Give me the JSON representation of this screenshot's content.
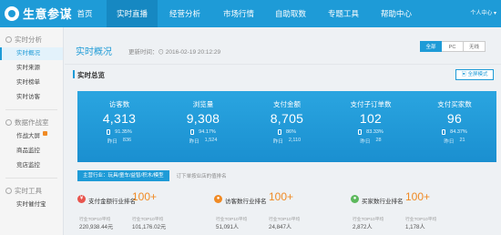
{
  "app": {
    "title": "生意参谋"
  },
  "nav": {
    "items": [
      "首页",
      "实时直播",
      "经营分析",
      "市场行情",
      "自助取数",
      "专题工具",
      "帮助中心"
    ],
    "active_index": 1,
    "user_menu": "个人中心 ▾"
  },
  "sidebar": {
    "groups": [
      {
        "title": "实时分析",
        "items": [
          "实时概况",
          "实时来源",
          "实时榜单",
          "实时访客"
        ]
      },
      {
        "title": "数据作战室",
        "items": [
          "作战大屏",
          "商品监控",
          "竞店监控"
        ]
      },
      {
        "title": "实时工具",
        "items": [
          "实时催付宝"
        ]
      }
    ],
    "active_item": "实时概况"
  },
  "header": {
    "title": "实时概况",
    "update_time": "更新时间：⊙ 2016-02-19 20:12:29",
    "device_options": [
      "全部",
      "PC",
      "无线"
    ],
    "selected_device": "全部"
  },
  "section": {
    "title": "实时总览",
    "fullscreen_label": "▣ 全屏模式"
  },
  "metrics": [
    {
      "label": "访客数",
      "value": "4,313",
      "mobile_pct": "91.35%",
      "yesterday_label": "昨日",
      "yesterday": "836"
    },
    {
      "label": "浏览量",
      "value": "9,308",
      "mobile_pct": "94.17%",
      "yesterday_label": "昨日",
      "yesterday": "1,524"
    },
    {
      "label": "支付金额",
      "value": "8,705",
      "mobile_pct": "86%",
      "yesterday_label": "昨日",
      "yesterday": "2,110"
    },
    {
      "label": "支付子订单数",
      "value": "102",
      "mobile_pct": "83.33%",
      "yesterday_label": "昨日",
      "yesterday": "28"
    },
    {
      "label": "支付买家数",
      "value": "96",
      "mobile_pct": "84.37%",
      "yesterday_label": "昨日",
      "yesterday": "21"
    }
  ],
  "rank_tabs": {
    "active": "主营行业：玩具/童车/益智/积木/模型",
    "link": "订下单按业店的值排名"
  },
  "rank_cards": [
    {
      "icon": "yen-icon",
      "icon_char": "¥",
      "icon_color": "#e8554e",
      "title": "支付金额行业排名",
      "rank": "100+",
      "col1_label": "行业TOP10平均",
      "col1_value": "220,938.44元",
      "col2_label": "行业TOP10平均",
      "col2_value": "101,176.02元"
    },
    {
      "icon": "visitor-icon",
      "icon_char": "●",
      "icon_color": "#f08a24",
      "title": "访客数行业排名",
      "rank": "100+",
      "col1_label": "行业TOP10平均",
      "col1_value": "51,091人",
      "col2_label": "行业TOP10平均",
      "col2_value": "24,847人"
    },
    {
      "icon": "buyer-icon",
      "icon_char": "●",
      "icon_color": "#5cb85c",
      "title": "买家数行业排名",
      "rank": "100+",
      "col1_label": "行业TOP10平均",
      "col1_value": "2,872人",
      "col2_label": "行业TOP10平均",
      "col2_value": "1,178人"
    }
  ]
}
